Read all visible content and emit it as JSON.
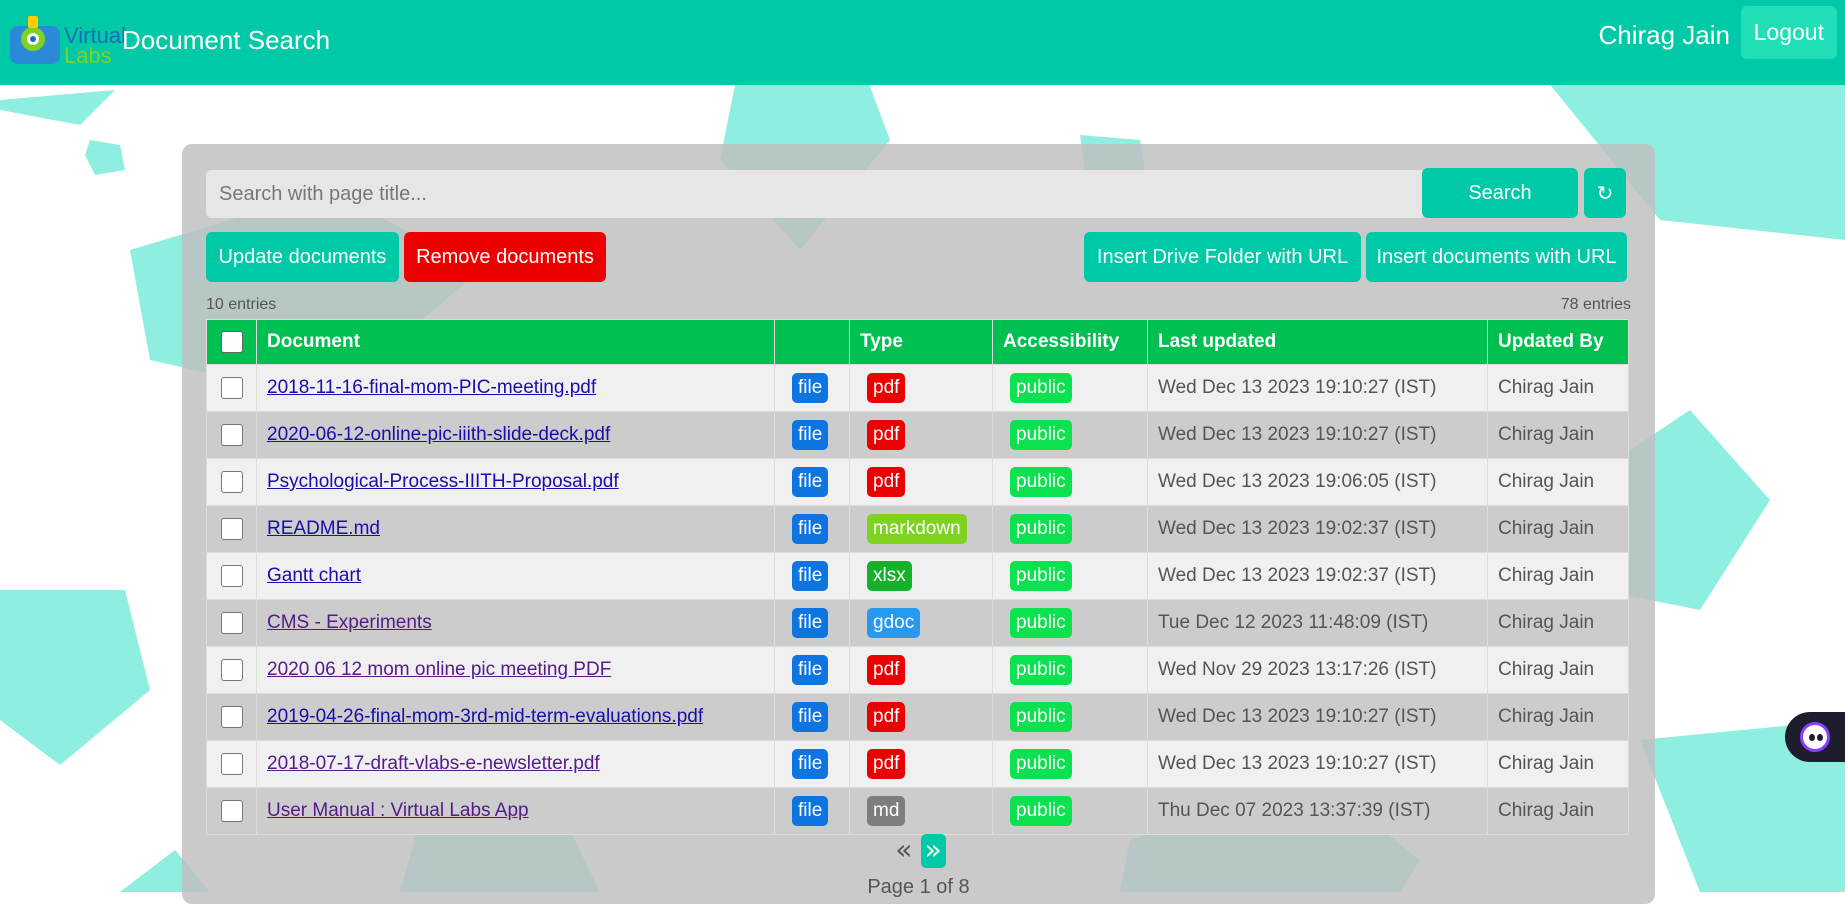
{
  "header": {
    "logo_line1": "Virtual",
    "logo_line2": "Labs",
    "title": "Document Search",
    "user": "Chirag Jain",
    "logout_label": "Logout"
  },
  "search": {
    "placeholder": "Search with page title...",
    "value": "",
    "button_label": "Search",
    "refresh_icon": "↻"
  },
  "actions": {
    "update": "Update documents",
    "remove": "Remove documents",
    "insert_folder": "Insert Drive Folder with URL",
    "insert_docs": "Insert documents with URL"
  },
  "entries": {
    "shown": "10 entries",
    "total": "78 entries"
  },
  "table": {
    "headers": [
      "Document",
      "",
      "Type",
      "Accessibility",
      "Last updated",
      "Updated By"
    ],
    "rows": [
      {
        "name": "2018-11-16-final-mom-PIC-meeting.pdf",
        "kind": "file",
        "type": "pdf",
        "access": "public",
        "updated": "Wed Dec 13 2023 19:10:27 (IST)",
        "by": "Chirag Jain"
      },
      {
        "name": "2020-06-12-online-pic-iiith-slide-deck.pdf",
        "kind": "file",
        "type": "pdf",
        "access": "public",
        "updated": "Wed Dec 13 2023 19:10:27 (IST)",
        "by": "Chirag Jain"
      },
      {
        "name": "Psychological-Process-IIITH-Proposal.pdf",
        "kind": "file",
        "type": "pdf",
        "access": "public",
        "updated": "Wed Dec 13 2023 19:06:05 (IST)",
        "by": "Chirag Jain"
      },
      {
        "name": "README.md",
        "kind": "file",
        "type": "markdown",
        "access": "public",
        "updated": "Wed Dec 13 2023 19:02:37 (IST)",
        "by": "Chirag Jain"
      },
      {
        "name": "Gantt chart",
        "kind": "file",
        "type": "xlsx",
        "access": "public",
        "updated": "Wed Dec 13 2023 19:02:37 (IST)",
        "by": "Chirag Jain"
      },
      {
        "name": "CMS - Experiments",
        "kind": "file",
        "type": "gdoc",
        "access": "public",
        "updated": "Tue Dec 12 2023 11:48:09 (IST)",
        "by": "Chirag Jain"
      },
      {
        "name": "2020 06 12 mom online pic meeting PDF",
        "kind": "file",
        "type": "pdf",
        "access": "public",
        "updated": "Wed Nov 29 2023 13:17:26 (IST)",
        "by": "Chirag Jain"
      },
      {
        "name": "2019-04-26-final-mom-3rd-mid-term-evaluations.pdf",
        "kind": "file",
        "type": "pdf",
        "access": "public",
        "updated": "Wed Dec 13 2023 19:10:27 (IST)",
        "by": "Chirag Jain"
      },
      {
        "name": "2018-07-17-draft-vlabs-e-newsletter.pdf",
        "kind": "file",
        "type": "pdf",
        "access": "public",
        "updated": "Wed Dec 13 2023 19:10:27 (IST)",
        "by": "Chirag Jain"
      },
      {
        "name": "User Manual : Virtual Labs App",
        "kind": "file",
        "type": "md",
        "access": "public",
        "updated": "Thu Dec 07 2023 13:37:39 (IST)",
        "by": "Chirag Jain"
      }
    ]
  },
  "pagination": {
    "prev": "«",
    "next": "»",
    "info": "Page 1 of 8"
  },
  "colors": {
    "primary": "#00c9a7",
    "header_row": "#00c051",
    "danger": "#ee0000",
    "badge_file": "#0e74e0",
    "badge_pdf": "#ea0000",
    "badge_public": "#0ce14f"
  },
  "icons": {
    "logo": "virtual-labs-logo",
    "refresh": "refresh-icon",
    "chat": "chatbot-icon"
  }
}
